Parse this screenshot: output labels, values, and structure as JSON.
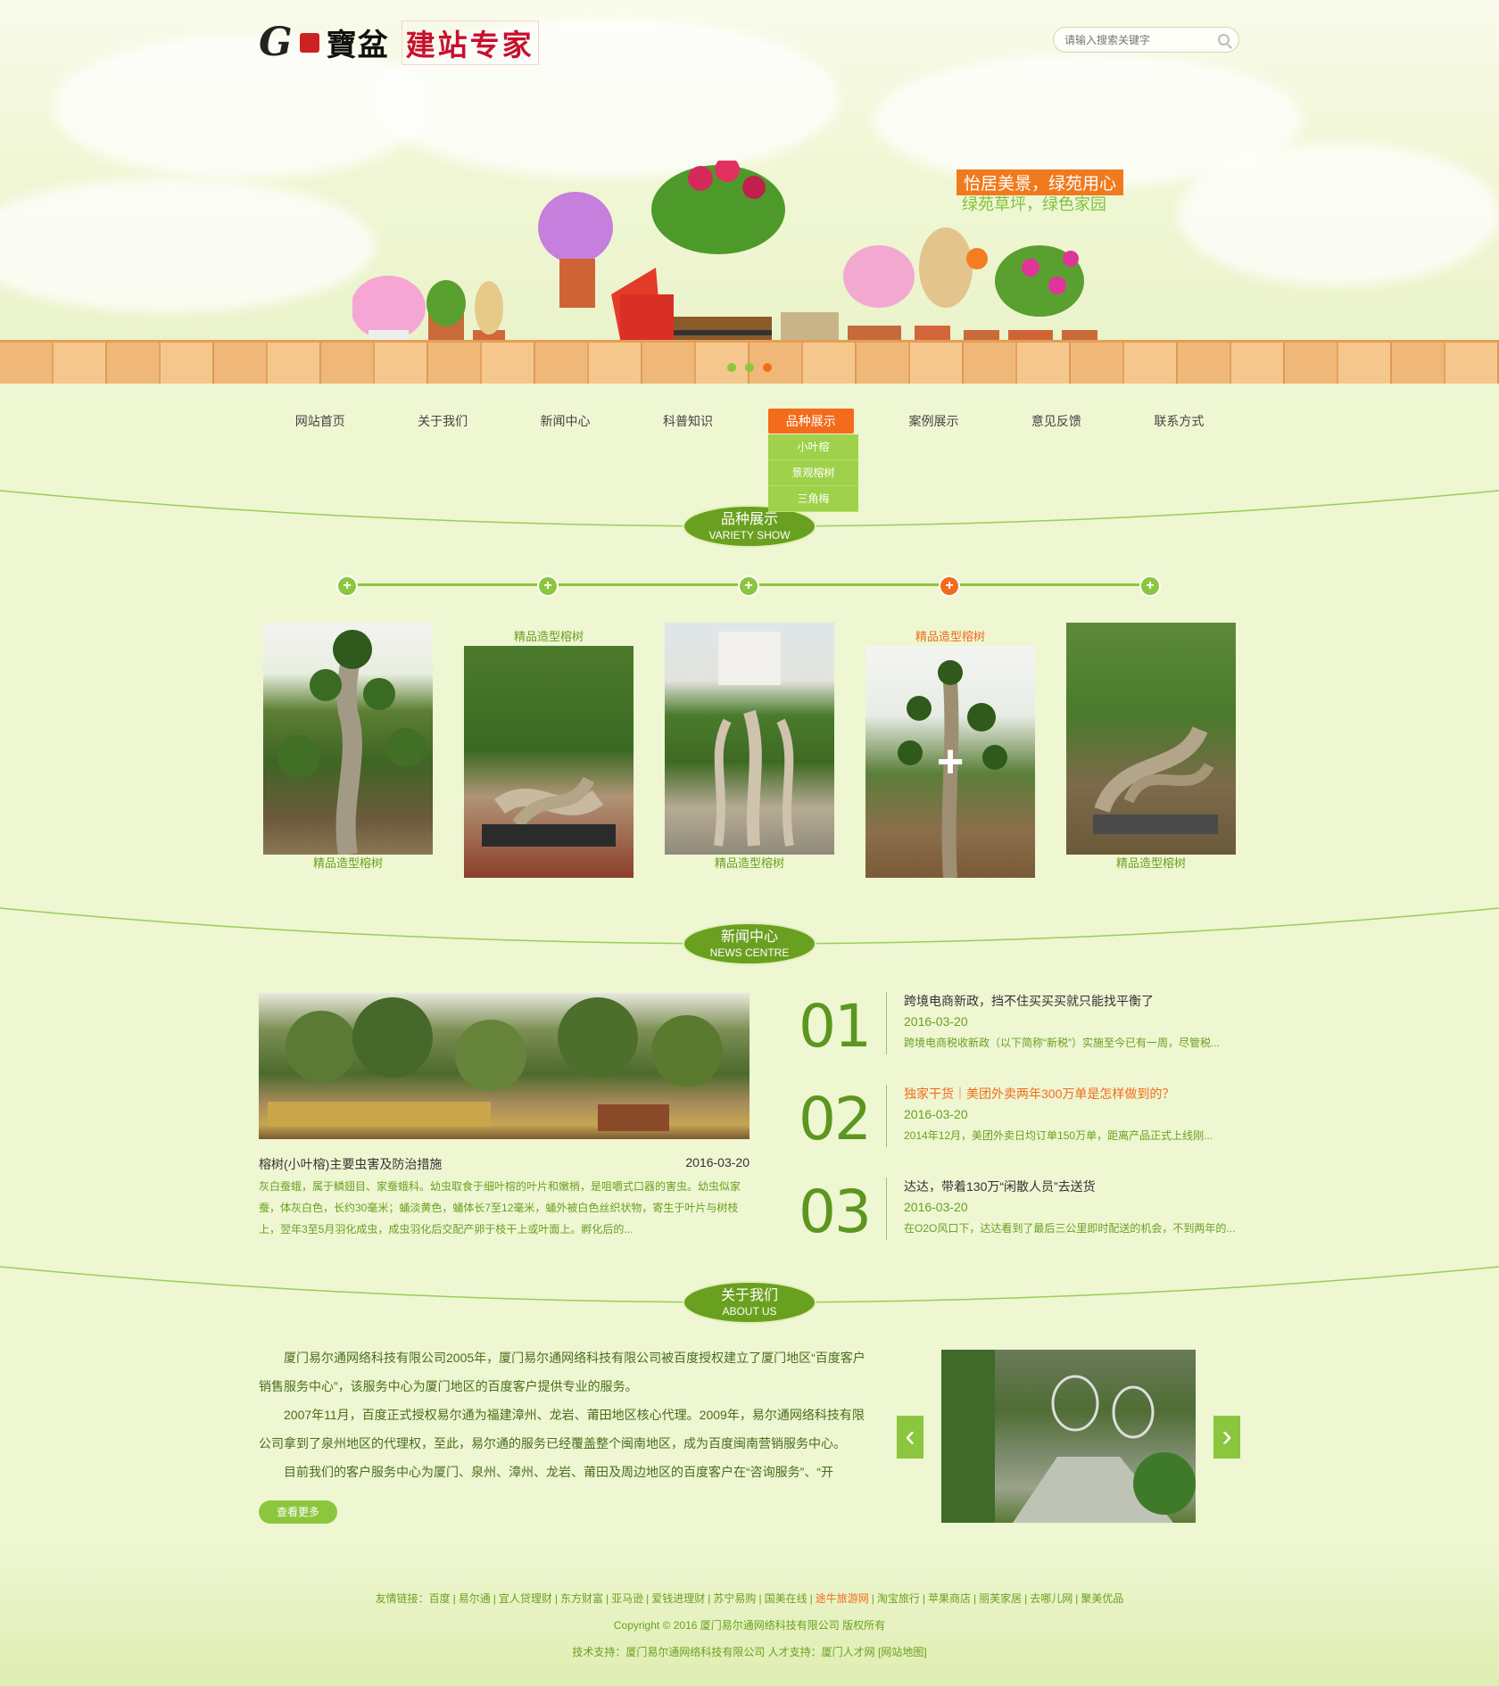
{
  "header": {
    "logo_letter": "G",
    "logo_brand": "寶盆",
    "logo_slogan": "建站专家",
    "search_placeholder": "请输入搜索关键字",
    "banner_tag1": "怡居美景，绿苑用心",
    "banner_tag2": "绿苑草坪，绿色家园"
  },
  "nav": {
    "items": [
      "网站首页",
      "关于我们",
      "新闻中心",
      "科普知识",
      "品种展示",
      "案例展示",
      "意见反馈",
      "联系方式"
    ],
    "active_index": 4,
    "submenu": [
      "小叶榕",
      "景观榕树",
      "三角梅"
    ]
  },
  "variety": {
    "title_cn": "品种展示",
    "title_en": "VARIETY SHOW",
    "cards": [
      {
        "label": "精品造型榕树",
        "label_position": "bottom"
      },
      {
        "label": "精品造型榕树",
        "label_position": "top"
      },
      {
        "label": "精品造型榕树",
        "label_position": "bottom"
      },
      {
        "label": "精品造型榕树",
        "label_position": "top",
        "highlighted": true
      },
      {
        "label": "精品造型榕树",
        "label_position": "bottom"
      }
    ]
  },
  "news": {
    "title_cn": "新闻中心",
    "title_en": "NEWS CENTRE",
    "feature": {
      "title": "榕树(小叶榕)主要虫害及防治措施",
      "date": "2016-03-20",
      "desc": "灰白蚕蛾，属于鳞翅目、家蚕蛾科。幼虫取食于细叶榕的叶片和嫩梢，是咀嚼式口器的害虫。幼虫似家蚕，体灰白色，长约30毫米；蛹淡黄色，蛹体长7至12毫米，蛹外被白色丝织状物，寄生于叶片与树枝上，翌年3至5月羽化成虫，成虫羽化后交配产卵于枝干上或叶面上。孵化后的..."
    },
    "items": [
      {
        "num": "01",
        "title": "跨境电商新政，挡不住买买买就只能找平衡了",
        "date": "2016-03-20",
        "summary": "跨境电商税收新政（以下简称“新税”）实施至今已有一周，尽管税...",
        "highlight": false
      },
      {
        "num": "02",
        "title": "独家干货｜美团外卖两年300万单是怎样做到的？",
        "date": "2016-03-20",
        "summary": "2014年12月，美团外卖日均订单150万单，距离产品正式上线刚...",
        "highlight": true
      },
      {
        "num": "03",
        "title": "达达，带着130万“闲散人员”去送货",
        "date": "2016-03-20",
        "summary": "在O2O风口下，达达看到了最后三公里即时配送的机会，不到两年的...",
        "highlight": false
      }
    ]
  },
  "about": {
    "title_cn": "关于我们",
    "title_en": "ABOUT US",
    "paragraphs": [
      "厦门易尔通网络科技有限公司2005年，厦门易尔通网络科技有限公司被百度授权建立了厦门地区“百度客户销售服务中心”，该服务中心为厦门地区的百度客户提供专业的服务。",
      "2007年11月，百度正式授权易尔通为福建漳州、龙岩、莆田地区核心代理。2009年，易尔通网络科技有限公司拿到了泉州地区的代理权，至此，易尔通的服务已经覆盖整个闽南地区，成为百度闽南营销服务中心。",
      "目前我们的客户服务中心为厦门、泉州、漳州、龙岩、莆田及周边地区的百度客户在“咨询服务”、“开"
    ],
    "more_label": "查看更多",
    "prev_label": "‹",
    "next_label": "›"
  },
  "footer": {
    "links_label": "友情链接：",
    "links": [
      "百度",
      "易尔通",
      "宜人贷理财",
      "东方财富",
      "亚马逊",
      "爱钱进理财",
      "苏宁易购",
      "国美在线",
      "途牛旅游网",
      "淘宝旅行",
      "苹果商店",
      "丽芙家居",
      "去哪儿网",
      "聚美优品"
    ],
    "links_highlight_index": 8,
    "copyright": "Copyright © 2016 厦门易尔通网络科技有限公司 版权所有",
    "support": "技术支持：厦门易尔通网络科技有限公司 人才支持：厦门人才网 [网站地图]"
  },
  "colors": {
    "accent_green": "#8cc63e",
    "dark_green": "#5c961f",
    "accent_orange": "#f26c1c",
    "background": "#eef6d2"
  }
}
